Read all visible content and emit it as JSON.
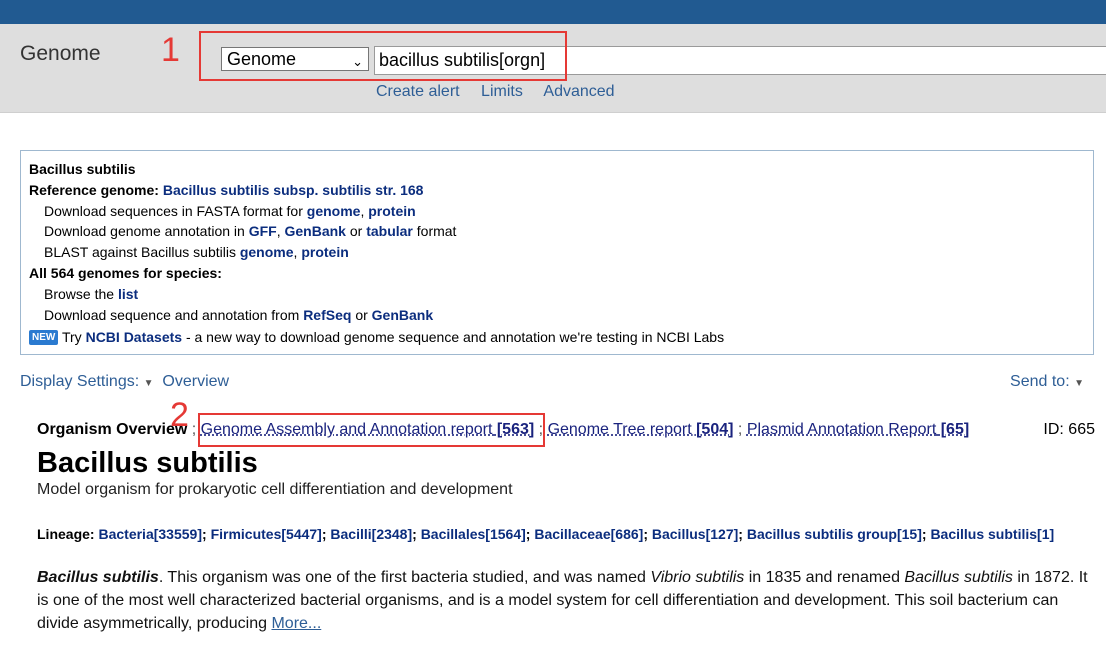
{
  "header": {
    "db_title": "Genome",
    "db_select": "Genome",
    "search_value": "bacillus subtilis[orgn]",
    "links": [
      "Create alert",
      "Limits",
      "Advanced"
    ]
  },
  "annotations": {
    "label1": "1",
    "label2": "2",
    "color": "#e53935"
  },
  "infobox": {
    "species": "Bacillus subtilis",
    "ref_label": "Reference genome:",
    "ref_link": "Bacillus subtilis subsp. subtilis str. 168",
    "fasta_prefix": "Download sequences in FASTA format for",
    "fasta_genome": "genome",
    "fasta_protein": "protein",
    "annot_prefix": "Download genome annotation in",
    "annot_gff": "GFF",
    "annot_genbank": "GenBank",
    "annot_or": "or",
    "annot_tabular": "tabular",
    "annot_suffix": "format",
    "blast_prefix": "BLAST against Bacillus subtilis",
    "blast_genome": "genome",
    "blast_protein": "protein",
    "all_label": "All 564 genomes for species:",
    "browse_prefix": "Browse the",
    "browse_list": "list",
    "dl_prefix": "Download sequence and annotation from",
    "dl_refseq": "RefSeq",
    "dl_or": "or",
    "dl_genbank": "GenBank",
    "new_badge": "NEW",
    "try_prefix": "Try",
    "datasets_link": "NCBI Datasets",
    "datasets_suffix": "- a new way to download genome sequence and annotation we're testing in NCBI Labs"
  },
  "display": {
    "settings": "Display Settings:",
    "overview": "Overview",
    "send_to": "Send to:"
  },
  "overview": {
    "label": "Organism Overview",
    "sep": ";",
    "assembly_text": "Genome Assembly and Annotation report",
    "assembly_count": "[563]",
    "tree_text": "Genome Tree report",
    "tree_count": "[504]",
    "plasmid_text": "Plasmid Annotation Report",
    "plasmid_count": "[65]",
    "id": "ID: 665"
  },
  "organism": {
    "title": "Bacillus subtilis",
    "subtitle": "Model organism for prokaryotic cell differentiation and development"
  },
  "lineage": {
    "label": "Lineage:",
    "items": [
      {
        "name": "Bacteria",
        "count": "[33559]"
      },
      {
        "name": "Firmicutes",
        "count": "[5447]"
      },
      {
        "name": "Bacilli",
        "count": "[2348]"
      },
      {
        "name": "Bacillales",
        "count": "[1564]"
      },
      {
        "name": "Bacillaceae",
        "count": "[686]"
      },
      {
        "name": "Bacillus",
        "count": "[127]"
      },
      {
        "name": "Bacillus subtilis group",
        "count": "[15]"
      },
      {
        "name": "Bacillus subtilis",
        "count": "[1]"
      }
    ]
  },
  "description": {
    "name_italic": "Bacillus subtilis",
    "part1": ". This organism was one of the first bacteria studied, and was named ",
    "vibrio": "Vibrio subtilis",
    "part2": " in 1835 and renamed ",
    "renamed": "Bacillus subtilis",
    "part3": " in 1872. It is one of the most well characterized bacterial organisms, and is a model system for cell differentiation and development. This soil bacterium can divide asymmetrically, producing ",
    "more": "More..."
  }
}
